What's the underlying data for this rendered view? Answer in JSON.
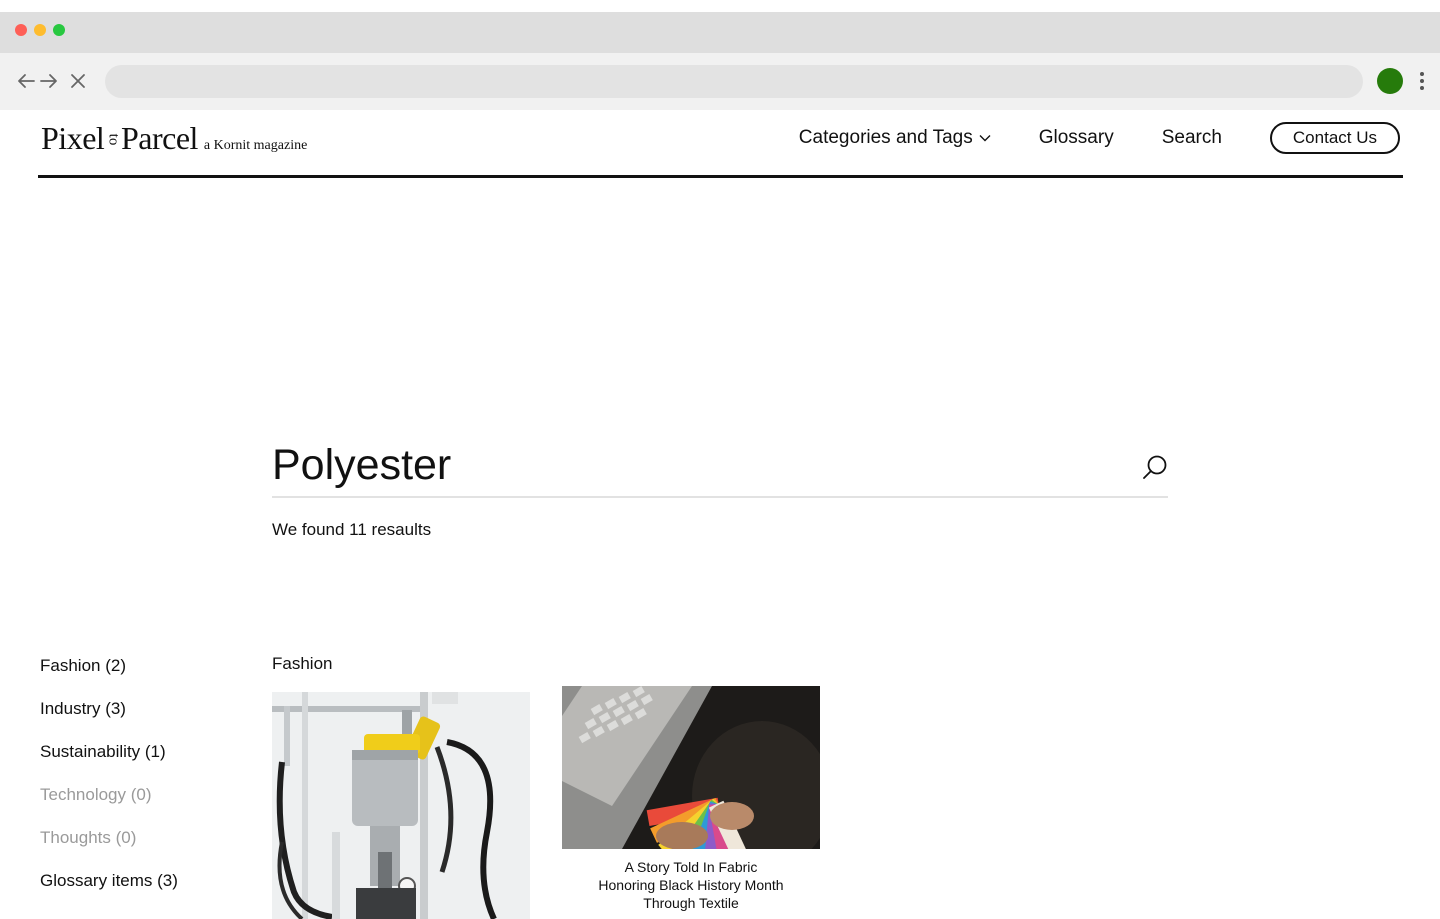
{
  "browser": {
    "address_value": "",
    "icons": [
      "back-arrow-icon",
      "forward-arrow-icon",
      "stop-icon",
      "profile-avatar",
      "more-vert-icon"
    ],
    "profile_color": "#267b0b"
  },
  "header": {
    "logo": {
      "word1": "Pixel",
      "word2": "to",
      "word3": "Parcel",
      "tagline": "a Kornit magazine"
    },
    "nav": {
      "categories_label": "Categories and Tags",
      "glossary_label": "Glossary",
      "search_label": "Search",
      "contact_label": "Contact Us"
    }
  },
  "search": {
    "value": "Polyester",
    "result_text": "We found 11 resaults"
  },
  "filters": [
    {
      "label": "Fashion (2)",
      "enabled": true
    },
    {
      "label": "Industry (3)",
      "enabled": true
    },
    {
      "label": "Sustainability (1)",
      "enabled": true
    },
    {
      "label": "Technology (0)",
      "enabled": false
    },
    {
      "label": "Thoughts (0)",
      "enabled": false
    },
    {
      "label": "Glossary items (3)",
      "enabled": true
    }
  ],
  "results": {
    "group_title": "Fashion",
    "cards": [
      {
        "title": ""
      },
      {
        "title_lines": [
          "A Story Told In Fabric",
          "Honoring Black History Month",
          "Through Textile"
        ]
      }
    ]
  }
}
